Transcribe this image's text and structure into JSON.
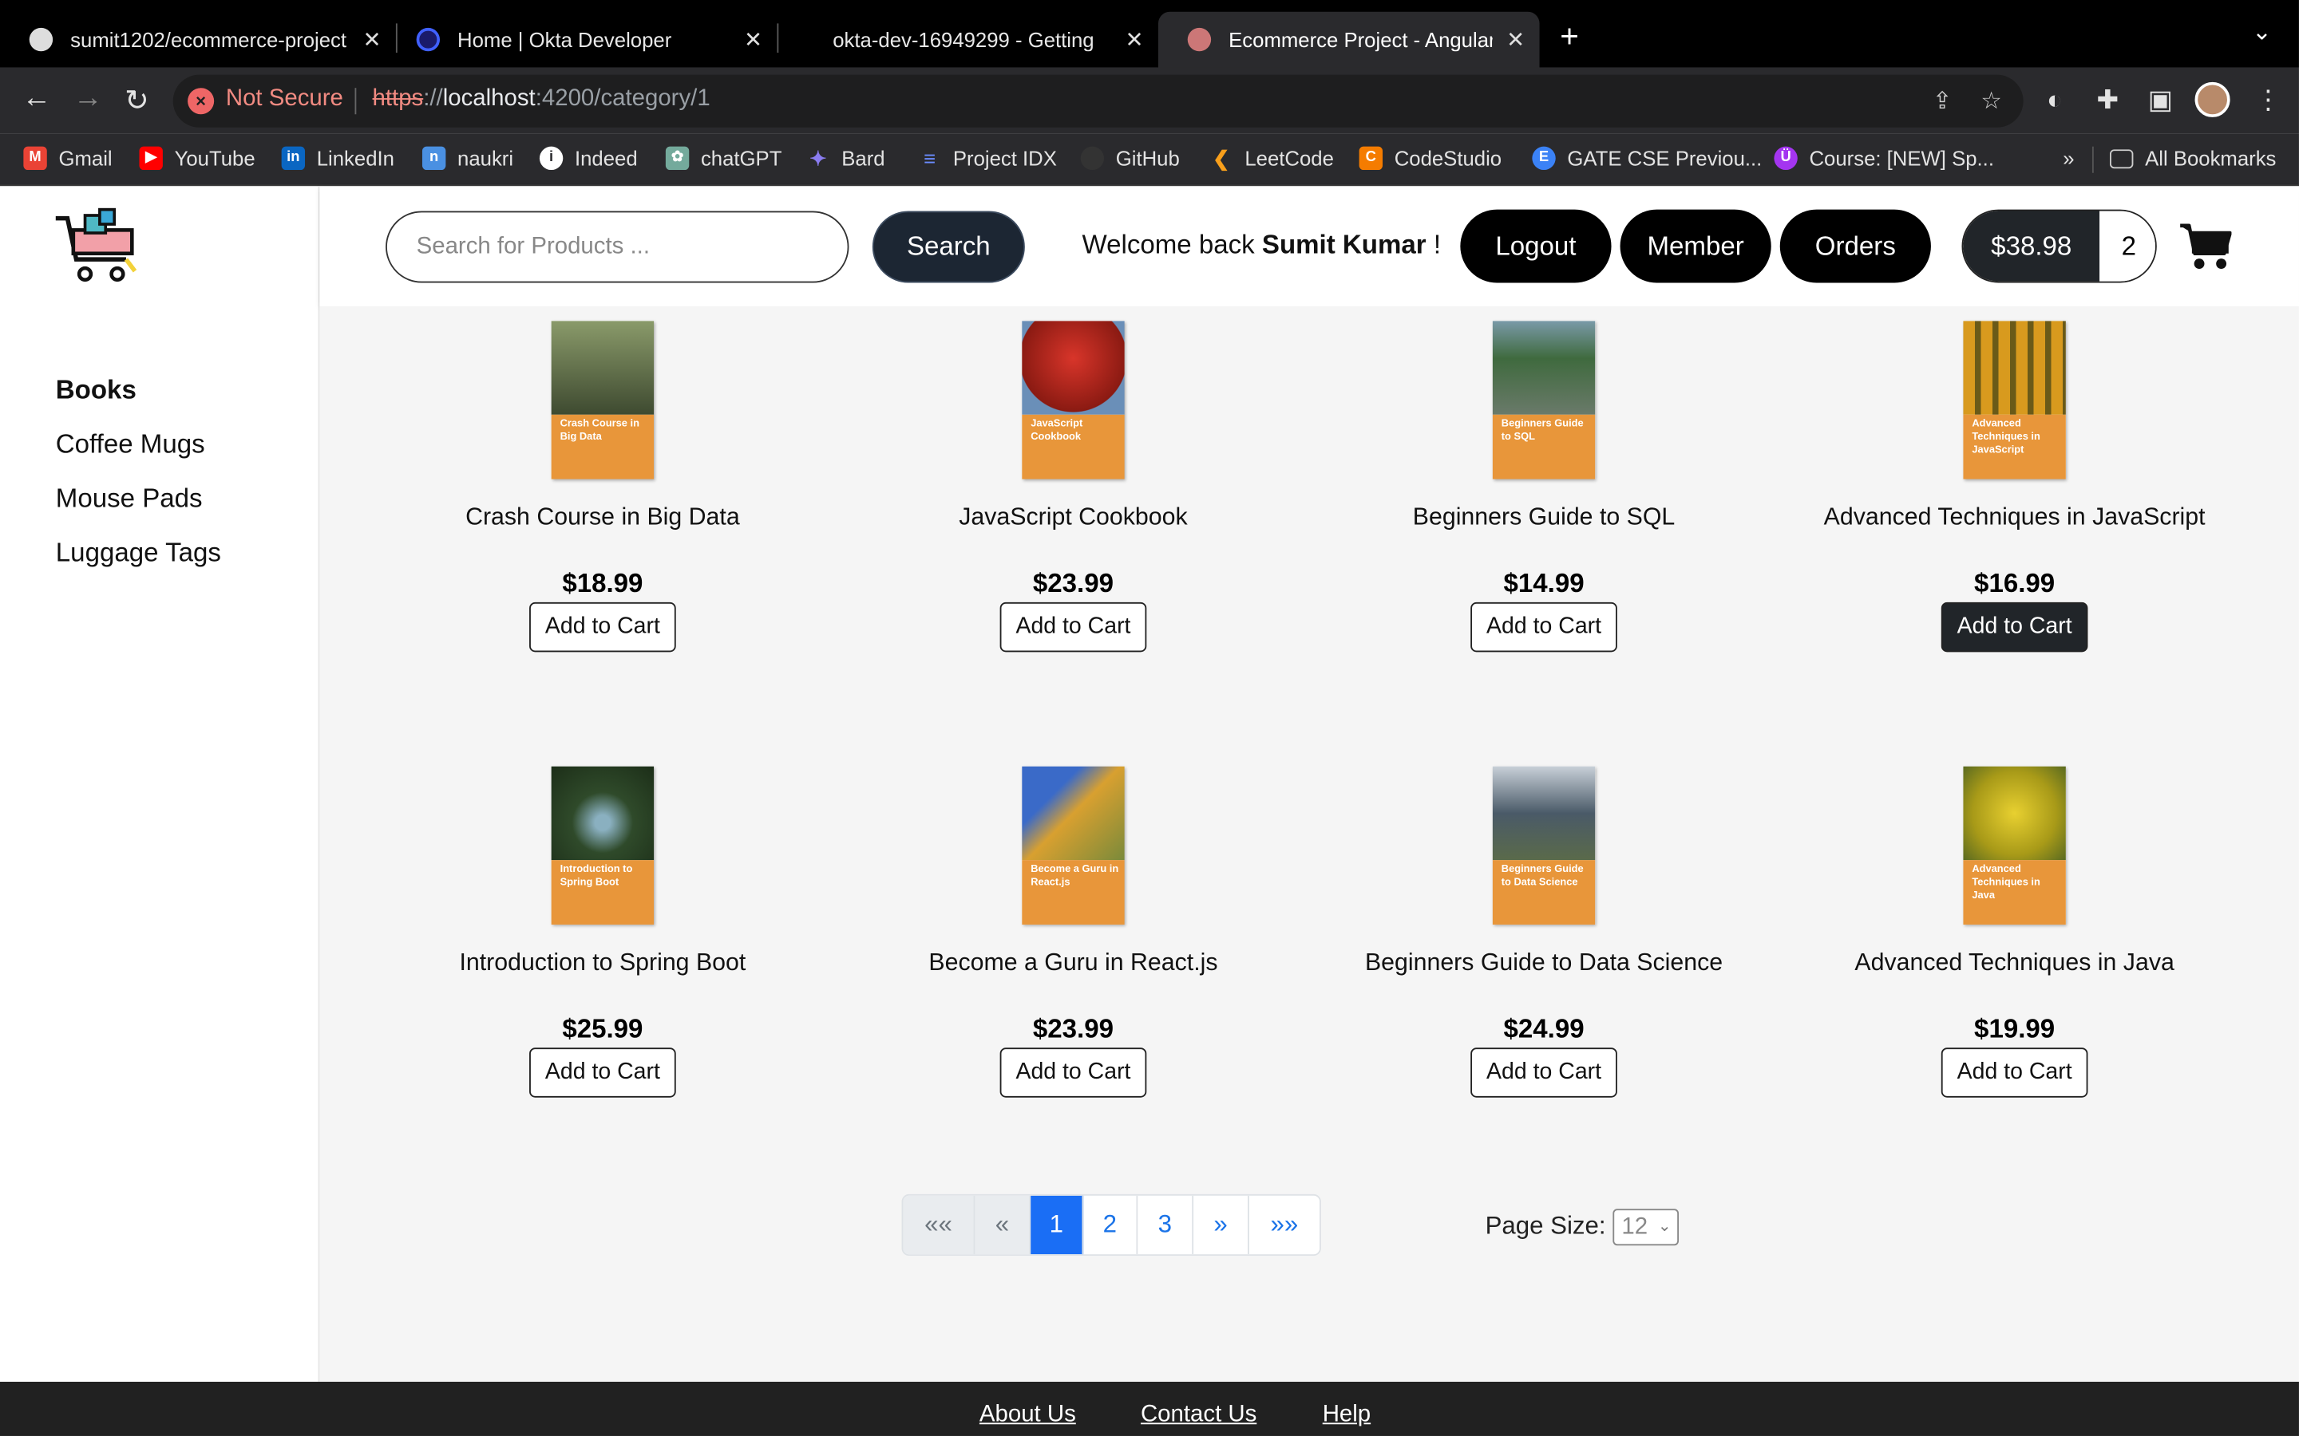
{
  "browser": {
    "tabs": [
      {
        "title": "sumit1202/ecommerce-project",
        "active": false
      },
      {
        "title": "Home | Okta Developer",
        "active": false
      },
      {
        "title": "okta-dev-16949299 - Getting",
        "active": false
      },
      {
        "title": "Ecommerce Project - Angular",
        "active": true
      }
    ],
    "security_label": "Not Secure",
    "url_scheme": "https",
    "url_sep": "://",
    "url_host": "localhost",
    "url_path": ":4200/category/1",
    "bookmarks": [
      {
        "label": "Gmail",
        "icon": "gmail-icon",
        "color": "#ea4335"
      },
      {
        "label": "YouTube",
        "icon": "youtube-icon",
        "color": "#ff0000"
      },
      {
        "label": "LinkedIn",
        "icon": "linkedin-icon",
        "color": "#0a66c2"
      },
      {
        "label": "naukri",
        "icon": "naukri-icon",
        "color": "#4a90e2"
      },
      {
        "label": "Indeed",
        "icon": "indeed-icon",
        "color": "#ffffff"
      },
      {
        "label": "chatGPT",
        "icon": "chatgpt-icon",
        "color": "#74aa9c"
      },
      {
        "label": "Bard",
        "icon": "bard-icon",
        "color": "#8a7cf0"
      },
      {
        "label": "Project IDX",
        "icon": "project-idx-icon",
        "color": "#6b8cff"
      },
      {
        "label": "GitHub",
        "icon": "github-icon",
        "color": "#333333"
      },
      {
        "label": "LeetCode",
        "icon": "leetcode-icon",
        "color": "#f89f1b"
      },
      {
        "label": "CodeStudio",
        "icon": "codestudio-icon",
        "color": "#f57c00"
      },
      {
        "label": "GATE CSE Previou...",
        "icon": "gate-icon",
        "color": "#3b82f6"
      },
      {
        "label": "Course: [NEW] Sp...",
        "icon": "udemy-icon",
        "color": "#a435f0"
      }
    ],
    "bookmarks_overflow": "»",
    "all_bookmarks": "All Bookmarks"
  },
  "header": {
    "search_placeholder": "Search for Products ...",
    "search_button": "Search",
    "welcome_prefix": "Welcome back",
    "user_name": "Sumit Kumar",
    "welcome_suffix": "!",
    "logout": "Logout",
    "member": "Member",
    "orders": "Orders",
    "cart_total": "$38.98",
    "cart_qty": "2"
  },
  "sidebar": {
    "categories": [
      "Books",
      "Coffee Mugs",
      "Mouse Pads",
      "Luggage Tags"
    ],
    "active": "Books"
  },
  "products": [
    {
      "name": "Crash Course in Big Data",
      "cover_title": "Crash Course in Big Data",
      "price": "$18.99",
      "button": "Add to Cart",
      "photo": "#5e6b4a"
    },
    {
      "name": "JavaScript Cookbook",
      "cover_title": "JavaScript Cookbook",
      "price": "$23.99",
      "button": "Add to Cart",
      "photo": "#b6261c"
    },
    {
      "name": "Beginners Guide to SQL",
      "cover_title": "Beginners Guide to SQL",
      "price": "$14.99",
      "button": "Add to Cart",
      "photo": "#4a6d48"
    },
    {
      "name": "Advanced Techniques in JavaScript",
      "cover_title": "Advanced Techniques in JavaScript",
      "price": "$16.99",
      "button": "Add to Cart",
      "photo": "#b07a1e"
    },
    {
      "name": "Introduction to Spring Boot",
      "cover_title": "Introduction to Spring Boot",
      "price": "$25.99",
      "button": "Add to Cart",
      "photo": "#2f4a2a"
    },
    {
      "name": "Become a Guru in React.js",
      "cover_title": "Become a Guru in React.js",
      "price": "$23.99",
      "button": "Add to Cart",
      "photo": "#c48a2a"
    },
    {
      "name": "Beginners Guide to Data Science",
      "cover_title": "Beginners Guide to Data Science",
      "price": "$24.99",
      "button": "Add to Cart",
      "photo": "#6f7f8f"
    },
    {
      "name": "Advanced Techniques in Java",
      "cover_title": "Advanced Techniques in Java",
      "price": "$19.99",
      "button": "Add to Cart",
      "photo": "#c9b02a"
    }
  ],
  "pagination": {
    "first": "««",
    "prev": "«",
    "pages": [
      "1",
      "2",
      "3"
    ],
    "current": "1",
    "next": "»",
    "last": "»»",
    "page_size_label": "Page Size:",
    "page_size_value": "12"
  },
  "footer": {
    "links": [
      "About Us",
      "Contact Us",
      "Help"
    ]
  }
}
